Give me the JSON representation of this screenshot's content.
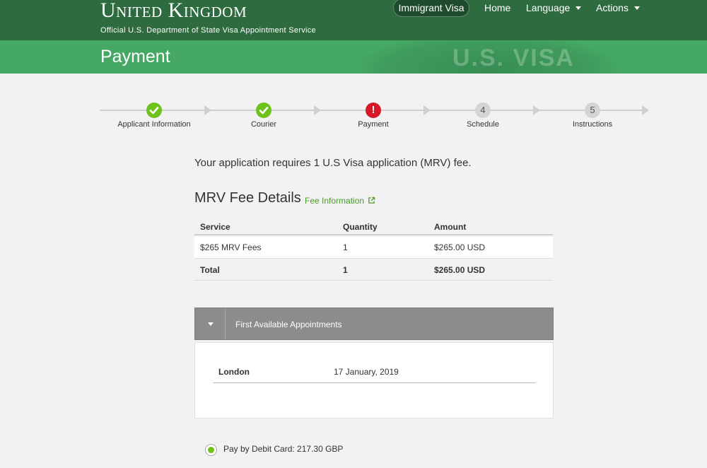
{
  "header": {
    "title": "United Kingdom",
    "subtitle": "Official U.S. Department of State Visa Appointment Service",
    "nav": {
      "immigrant_visa": "Immigrant Visa",
      "home": "Home",
      "language": "Language",
      "actions": "Actions"
    }
  },
  "banner": {
    "title": "Payment",
    "watermark": "U.S. VISA"
  },
  "steps": [
    {
      "label": "Applicant Information",
      "status": "complete",
      "number": ""
    },
    {
      "label": "Courier",
      "status": "complete",
      "number": ""
    },
    {
      "label": "Payment",
      "status": "error",
      "number": "!"
    },
    {
      "label": "Schedule",
      "status": "pending",
      "number": "4"
    },
    {
      "label": "Instructions",
      "status": "pending",
      "number": "5"
    }
  ],
  "intro": "Your application requires 1 U.S Visa application (MRV) fee.",
  "fee_details": {
    "title": "MRV Fee Details",
    "link": "Fee Information",
    "columns": [
      "Service",
      "Quantity",
      "Amount"
    ],
    "rows": [
      {
        "service": "$265 MRV Fees",
        "quantity": "1",
        "amount": "$265.00 USD"
      }
    ],
    "total": {
      "service": "Total",
      "quantity": "1",
      "amount": "$265.00 USD"
    }
  },
  "appointments": {
    "title": "First Available Appointments",
    "items": [
      {
        "location": "London",
        "date": "17 January, 2019"
      }
    ]
  },
  "payment": {
    "option_label": "Pay by Debit Card: 217.30 GBP"
  },
  "colors": {
    "header": "#2e6b3f",
    "banner": "#45a864",
    "complete": "#6fc21b",
    "error": "#d7182a",
    "link": "#4a9c2a"
  }
}
